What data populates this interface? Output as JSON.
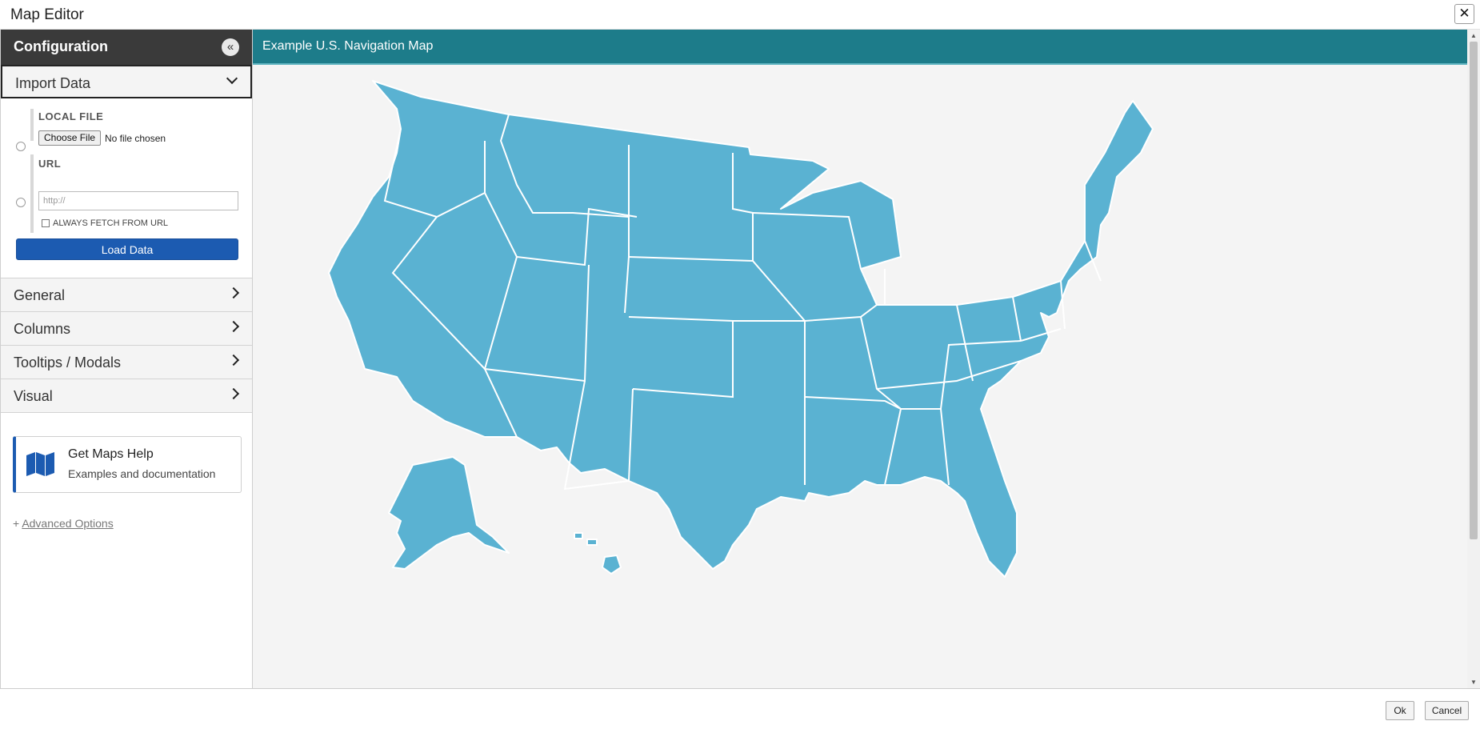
{
  "window": {
    "title": "Map Editor",
    "close_glyph": "✕"
  },
  "sidebar": {
    "header": "Configuration",
    "collapse_glyph": "«",
    "import": {
      "label": "Import Data",
      "local_file_label": "LOCAL FILE",
      "choose_file": "Choose File",
      "no_file": "No file chosen",
      "url_label": "URL",
      "url_placeholder": "http://",
      "always_fetch": "ALWAYS FETCH FROM URL",
      "load_button": "Load Data"
    },
    "sections": [
      {
        "label": "General"
      },
      {
        "label": "Columns"
      },
      {
        "label": "Tooltips / Modals"
      },
      {
        "label": "Visual"
      }
    ],
    "help": {
      "title": "Get Maps Help",
      "subtitle": "Examples and documentation"
    },
    "advanced": {
      "prefix": "+",
      "label": "Advanced Options"
    }
  },
  "main": {
    "title": "Example U.S. Navigation Map",
    "map_fill": "#5ab2d2",
    "header_color": "#1d7c8a"
  },
  "footer": {
    "ok": "Ok",
    "cancel": "Cancel"
  }
}
